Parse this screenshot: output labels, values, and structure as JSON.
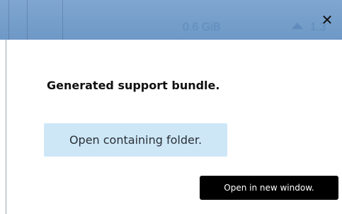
{
  "toolbar": {
    "size_stat": "0.6 GiB",
    "rate_stat": "1.3",
    "upload_icon": "up-arrow-icon"
  },
  "dialog": {
    "close_glyph": "✕",
    "heading": "Generated support bundle.",
    "open_folder_label": "Open containing folder.",
    "open_new_window_label": "Open in new window."
  },
  "colors": {
    "toolbar_bg": "#7fa6d0",
    "button_bg": "#cde7f7",
    "tooltip_bg": "#000000"
  }
}
